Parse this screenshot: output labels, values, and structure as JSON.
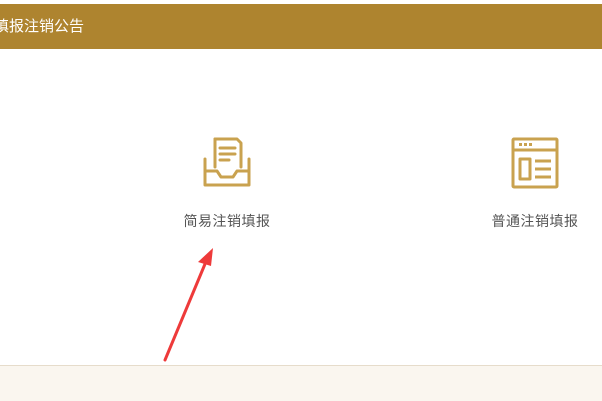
{
  "header": {
    "title": "填报注销公告"
  },
  "options": [
    {
      "label": "简易注销填报",
      "icon": "inbox-tray-icon"
    },
    {
      "label": "普通注销填报",
      "icon": "document-form-icon"
    }
  ],
  "annotation": {
    "arrow_color": "#ee3a3a",
    "icon_color": "#c9a24f",
    "accent": "#ae842f"
  }
}
